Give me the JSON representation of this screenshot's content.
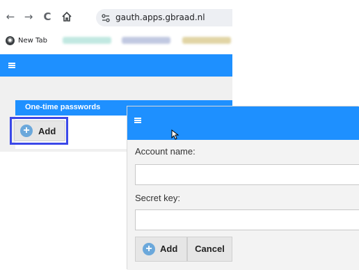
{
  "browser": {
    "url": "gauth.apps.gbraad.nl",
    "icons": [
      "back-arrow-icon",
      "forward-arrow-icon",
      "reload-icon",
      "home-icon",
      "site-info-icon"
    ],
    "bookmarks": {
      "new_tab_label": "New Tab",
      "blurred_colors": [
        "#8fd6c9",
        "#8e9cc9",
        "#c9b25c"
      ]
    }
  },
  "app_back": {
    "section_title": "One-time passwords",
    "add_label": "Add",
    "header_color": "#1e90ff"
  },
  "dialog": {
    "account_name_label": "Account name:",
    "account_name_value": "",
    "secret_key_label": "Secret key:",
    "secret_key_value": "",
    "add_label": "Add",
    "cancel_label": "Cancel"
  },
  "colors": {
    "accent": "#1e90ff",
    "focus_outline": "#3b48e8",
    "plus_icon": "#6ba8db"
  }
}
